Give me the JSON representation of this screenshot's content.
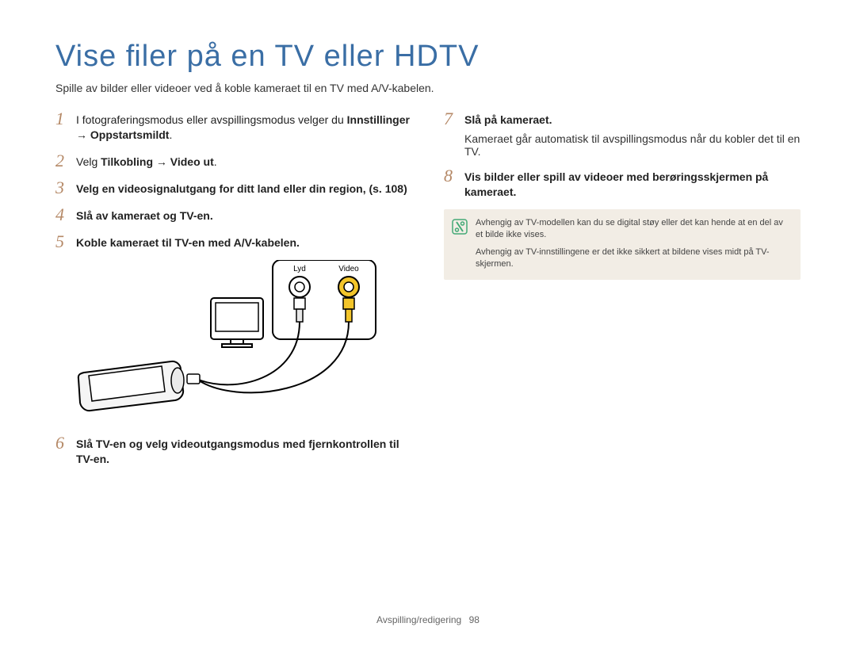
{
  "title": "Vise ﬁler på en TV eller HDTV",
  "intro": "Spille av bilder eller videoer ved å koble kameraet til en TV med A/V-kabelen.",
  "left": {
    "s1_regular": "I fotograferingsmodus eller avspillingsmodus velger du ",
    "s1_bold": "Innstillinger → Oppstartsmildt",
    "s2_regular": "Velg ",
    "s2_bold_a": "Tilkobling",
    "s2_arrow": " → ",
    "s2_bold_b": "Video ut",
    "s3_bold": "Velg en videosignalutgang for ditt land eller din region, (s. 108)",
    "s4_bold": "Slå av kameraet og TV-en.",
    "s5_bold": "Koble kameraet til TV-en med A/V-kabelen.",
    "s6_bold": "Slå TV-en og velg videoutgangsmodus med fjernkontrollen til TV-en."
  },
  "right": {
    "s7_bold": "Slå på kameraet.",
    "s7_sub": "Kameraet går automatisk til avspillingsmodus når du kobler det til en TV.",
    "s8_bold": "Vis bilder eller spill av videoer med berøringsskjermen på kameraet.",
    "note1": "Avhengig av TV-modellen kan du se digital støy eller det kan hende at en del av et bilde ikke vises.",
    "note2": "Avhengig av TV-innstillingene er det ikke sikkert at bildene vises midt på TV-skjermen."
  },
  "diagram": {
    "label_audio": "Lyd",
    "label_video": "Video"
  },
  "footer": {
    "section": "Avspilling/redigering",
    "page": "98"
  }
}
